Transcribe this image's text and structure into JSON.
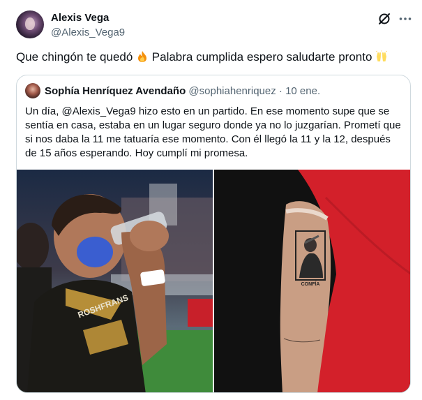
{
  "author": {
    "name": "Alexis Vega",
    "handle": "@Alexis_Vega9"
  },
  "tweet": {
    "text": "Que chingón te quedó",
    "text_after_emoji": "Palabra cumplida espero saludarte pronto",
    "emojis": [
      "fire-emoji",
      "raised-hands-emoji"
    ]
  },
  "quoted_tweet": {
    "name": "Sophía Henríquez Avendaño",
    "handle": "@sophiahenriquez",
    "separator": "·",
    "date": "10 ene.",
    "text": "Un día, @Alexis_Vega9 hizo esto en un partido. En ese momento supe que se sentía en casa, estaba en un lugar seguro donde ya no lo juzgarían. Prometí que si nos daba la 11 me tatuaría ese momento. Con él llegó la 11 y la 12, después de 15 años esperando. Hoy cumplí mi promesa.",
    "media": {
      "left": {
        "jersey_text": "ROSHFRANS"
      },
      "right": {
        "tattoo_caption": "CONFÍA"
      }
    }
  },
  "icons": [
    "grok-icon",
    "more-icon"
  ],
  "colors": {
    "text": "#0f1419",
    "secondary": "#536471",
    "border": "#cfd9de",
    "jersey": "#1b1a16",
    "jersey_gold": "#c89b3c",
    "shirt_red": "#d3202a"
  }
}
